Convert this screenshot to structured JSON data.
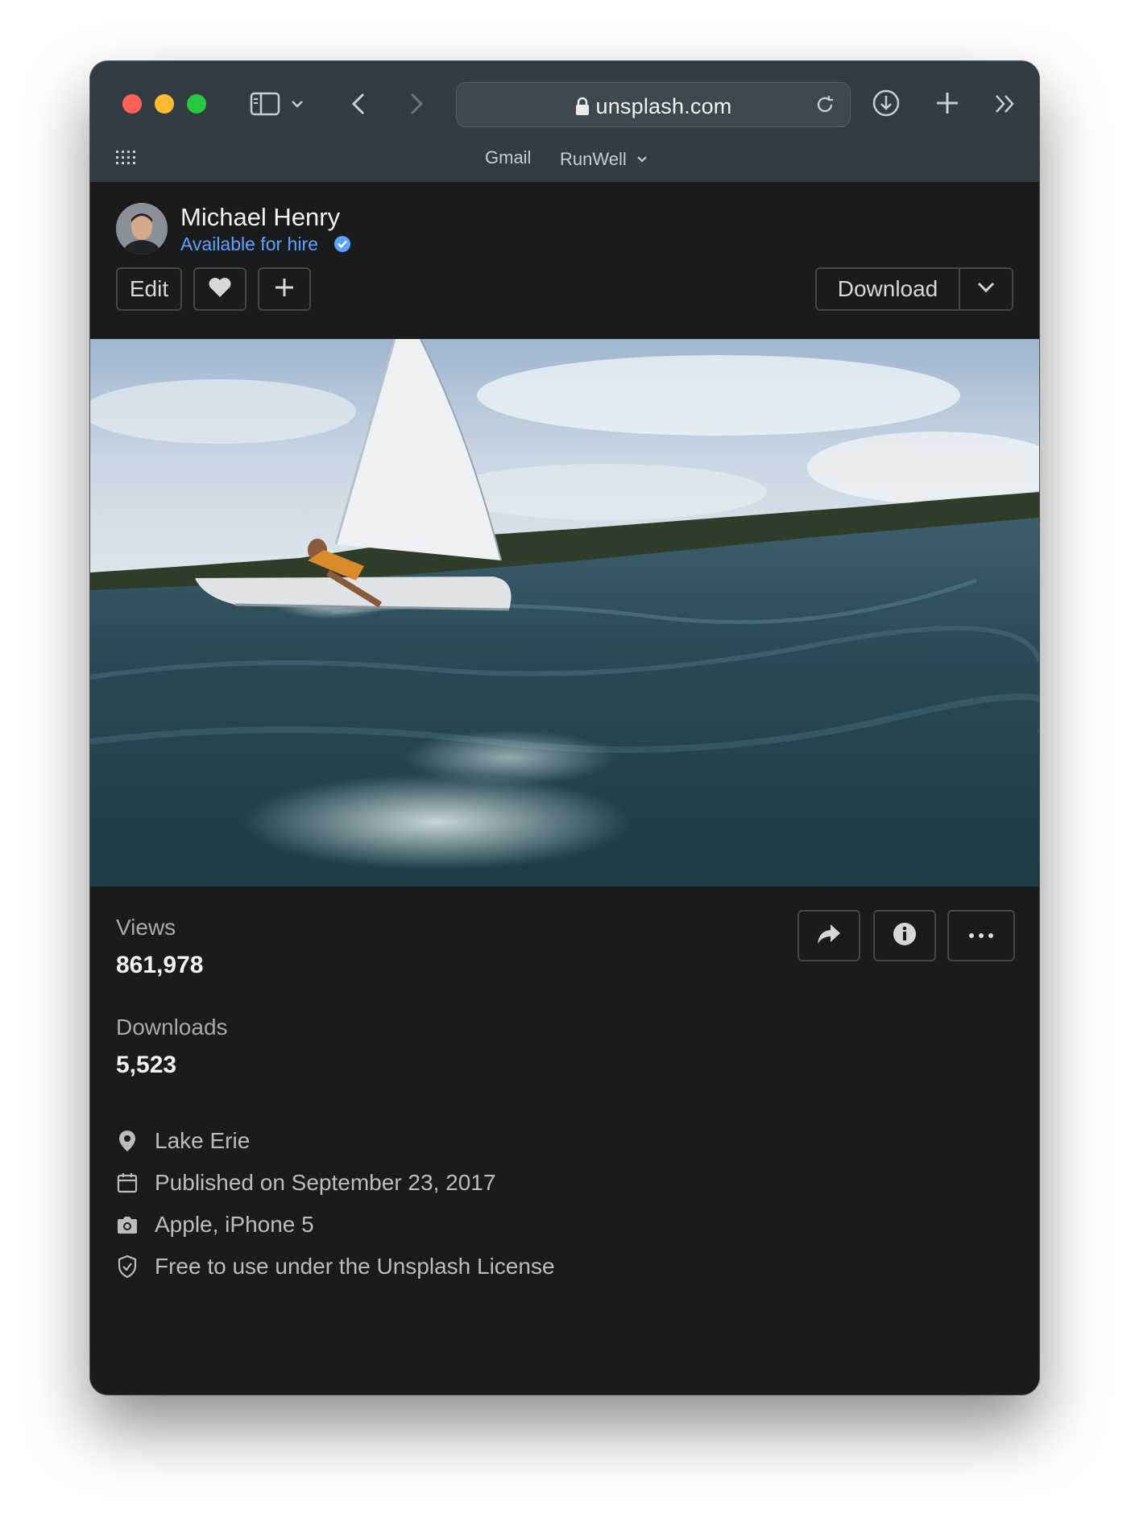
{
  "browser": {
    "url": "unsplash.com",
    "bookmarks": [
      "Gmail",
      "RunWell"
    ]
  },
  "profile": {
    "name": "Michael Henry",
    "hire_status": "Available for hire"
  },
  "actions": {
    "edit_label": "Edit",
    "download_label": "Download"
  },
  "stats": {
    "views_label": "Views",
    "views_value": "861,978",
    "downloads_label": "Downloads",
    "downloads_value": "5,523"
  },
  "meta": {
    "location": "Lake Erie",
    "published": "Published on September 23, 2017",
    "camera": "Apple, iPhone 5",
    "license": "Free to use under the Unsplash License"
  },
  "colors": {
    "accent_blue": "#5aa4ff",
    "window_bg": "#1a1b1d",
    "toolbar_bg": "#343c43"
  }
}
